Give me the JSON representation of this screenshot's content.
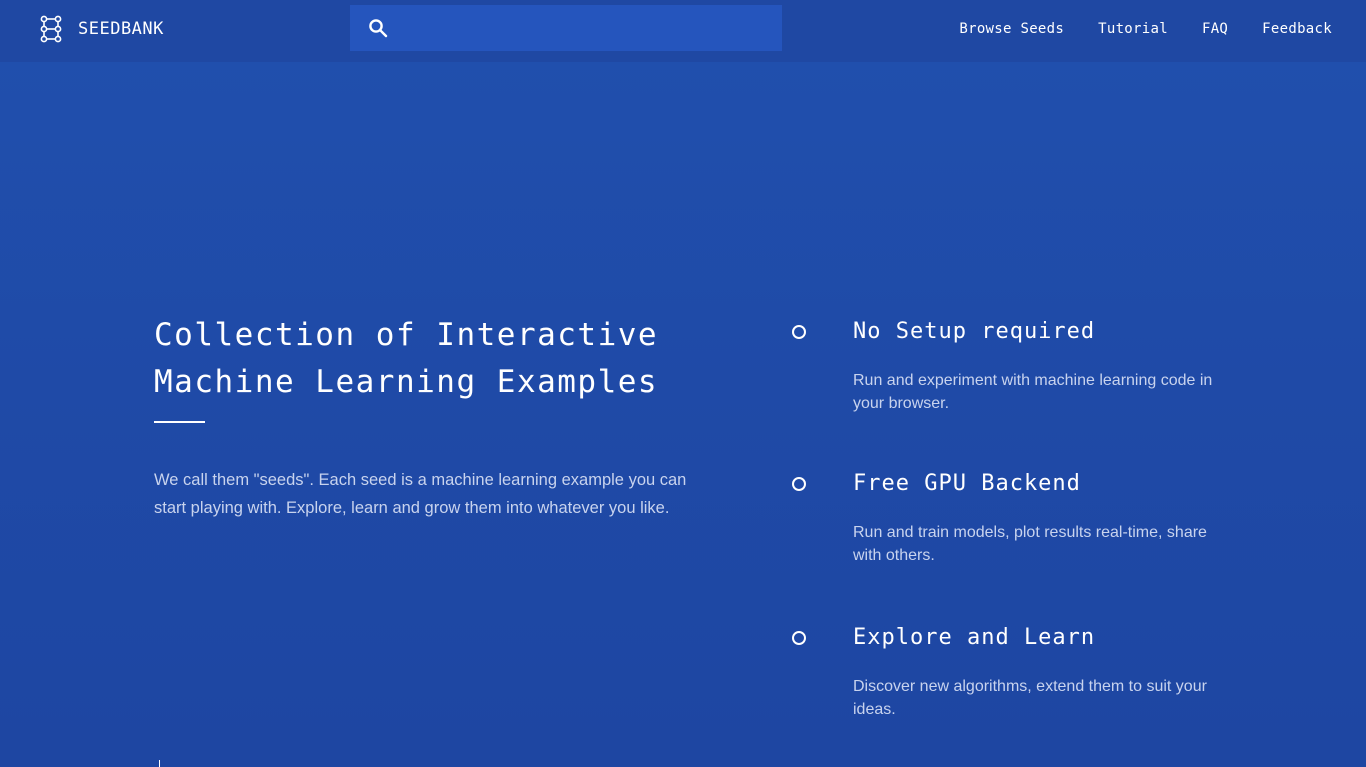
{
  "header": {
    "brand": "SEEDBANK",
    "brand_icon": "seed-network-icon",
    "search": {
      "placeholder": "",
      "value": "",
      "icon": "search-icon"
    },
    "nav": [
      {
        "label": "Browse Seeds"
      },
      {
        "label": "Tutorial"
      },
      {
        "label": "FAQ"
      },
      {
        "label": "Feedback"
      }
    ]
  },
  "hero": {
    "title_line1": "Collection of Interactive",
    "title_line2": "Machine Learning Examples",
    "description": "We call them \"seeds\". Each seed is a machine learning example you can start playing with. Explore, learn and grow them into whatever you like."
  },
  "features": [
    {
      "title": "No Setup required",
      "description": "Run and experiment with machine learning code in your browser."
    },
    {
      "title": "Free GPU Backend",
      "description": "Run and train models, plot results real-time, share with others."
    },
    {
      "title": "Explore and Learn",
      "description": "Discover new algorithms, extend them to suit your ideas."
    }
  ],
  "colors": {
    "background": "#1f4aa7",
    "header": "#1f48a3",
    "search_box": "#2555bd",
    "text": "#ffffff",
    "muted_text": "#c8d3ee"
  }
}
